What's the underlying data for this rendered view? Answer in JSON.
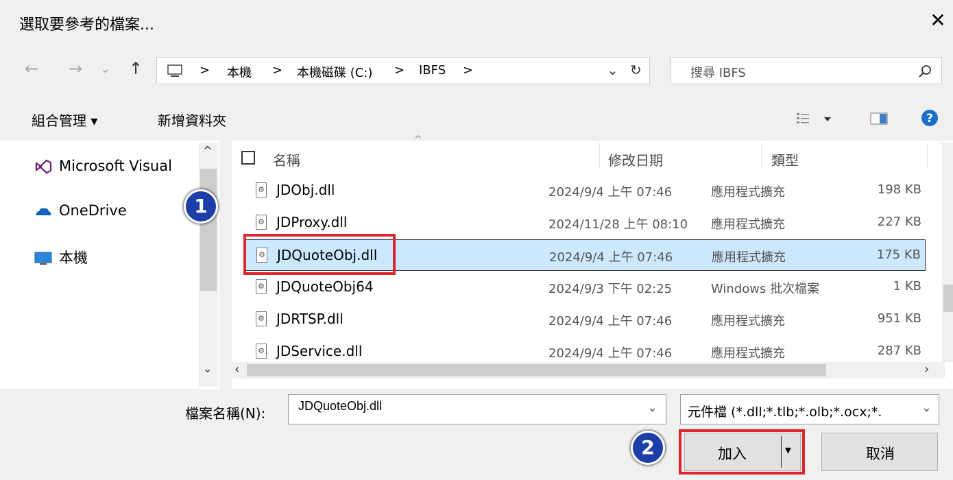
{
  "dialog": {
    "title": "選取要參考的檔案...",
    "close": "✕"
  },
  "nav": {
    "back": "←",
    "forward": "→",
    "dropdown": "⌄",
    "up": "↑"
  },
  "address": {
    "crumbs": [
      "本機",
      "本機磁碟 (C:)",
      "IBFS"
    ],
    "separator": ">"
  },
  "search": {
    "placeholder": "搜尋 IBFS"
  },
  "toolbar": {
    "organize": "組合管理 ▾",
    "new_folder": "新增資料夾"
  },
  "sidebar": {
    "items": [
      {
        "label": "Microsoft Visual",
        "icon": "visual-studio-icon"
      },
      {
        "label": "OneDrive",
        "icon": "onedrive-icon"
      },
      {
        "label": "本機",
        "icon": "computer-icon"
      }
    ]
  },
  "columns": {
    "name": "名稱",
    "modified": "修改日期",
    "type": "類型"
  },
  "files": [
    {
      "name": "JDObj.dll",
      "modified": "2024/9/4 上午 07:46",
      "type": "應用程式擴充",
      "size": "198 KB"
    },
    {
      "name": "JDProxy.dll",
      "modified": "2024/11/28 上午 08:10",
      "type": "應用程式擴充",
      "size": "227 KB"
    },
    {
      "name": "JDQuoteObj.dll",
      "modified": "2024/9/4 上午 07:46",
      "type": "應用程式擴充",
      "size": "175 KB",
      "selected": true
    },
    {
      "name": "JDQuoteObj64",
      "modified": "2024/9/3 下午 02:25",
      "type": "Windows 批次檔案",
      "size": "1 KB"
    },
    {
      "name": "JDRTSP.dll",
      "modified": "2024/9/4 上午 07:46",
      "type": "應用程式擴充",
      "size": "951 KB"
    },
    {
      "name": "JDService.dll",
      "modified": "2024/9/4 上午 07:46",
      "type": "應用程式擴充",
      "size": "287 KB"
    }
  ],
  "bottom": {
    "filename_label": "檔案名稱(N):",
    "filename_value": "JDQuoteObj.dll",
    "filter_value": "元件檔 (*.dll;*.tlb;*.olb;*.ocx;*.",
    "add_label": "加入",
    "cancel_label": "取消"
  },
  "badges": {
    "one": "1",
    "two": "2"
  },
  "colors": {
    "highlight": "#e0242c",
    "selection": "#cce8ff",
    "badge": "#1d3ea8"
  }
}
